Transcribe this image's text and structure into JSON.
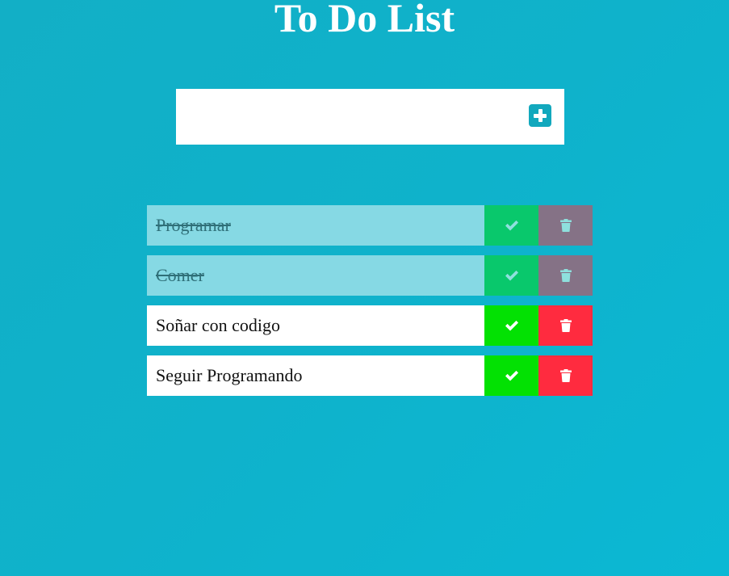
{
  "header": {
    "title": "To Do List"
  },
  "new_task": {
    "value": "",
    "placeholder": ""
  },
  "colors": {
    "background": "#0fb2cb",
    "check_active": "#03e103",
    "check_done": "#09c86c",
    "delete_active": "#ff2b3f",
    "delete_done": "#857286",
    "completed_row": "#86d9e4"
  },
  "tasks": [
    {
      "text": "Programar",
      "completed": true
    },
    {
      "text": "Comer",
      "completed": true
    },
    {
      "text": "Soñar con codigo",
      "completed": false
    },
    {
      "text": "Seguir Programando",
      "completed": false
    }
  ],
  "icons": {
    "add": "plus-square-icon",
    "complete": "check-icon",
    "delete": "trash-icon"
  }
}
